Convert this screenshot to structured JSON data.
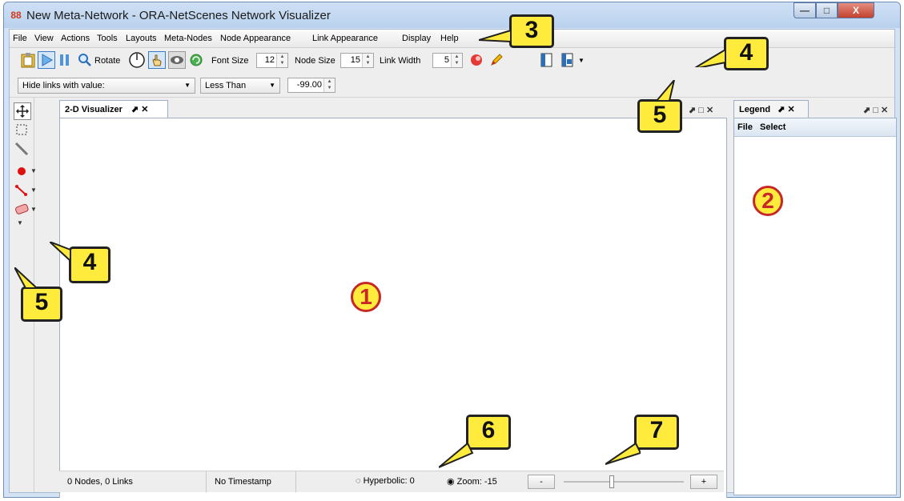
{
  "window": {
    "title": "New Meta-Network - ORA-NetScenes Network Visualizer",
    "minimize": "—",
    "maximize": "□",
    "close": "X"
  },
  "menu": [
    "File",
    "View",
    "Actions",
    "Tools",
    "Layouts",
    "Meta-Nodes",
    "Node Appearance",
    "Link Appearance",
    "Display",
    "Help"
  ],
  "toolbar": {
    "rotate_label": "Rotate",
    "font_size_label": "Font Size",
    "font_size_value": "12",
    "node_size_label": "Node Size",
    "node_size_value": "15",
    "link_width_label": "Link Width",
    "link_width_value": "5"
  },
  "filter": {
    "hide_links": "Hide links with value:",
    "comparison": "Less Than",
    "threshold": "-99.00"
  },
  "visualizer_tab": {
    "title": "2-D Visualizer",
    "controls": "⬈ ✕"
  },
  "visualizer_panel_controls": "⬈ □ ✕",
  "legend": {
    "title": "Legend",
    "controls": "⬈ ✕",
    "panel_controls": "⬈ □ ✕",
    "menu_file": "File",
    "menu_select": "Select"
  },
  "status": {
    "nodes_links": "0 Nodes, 0 Links",
    "timestamp": "No Timestamp",
    "hyperbolic": "Hyperbolic: 0",
    "zoom": "Zoom: -15",
    "zoom_out": "-",
    "zoom_in": "+",
    "zoom_slider_level": 0.4
  },
  "annotations": {
    "c1": "1",
    "c2": "2",
    "c3": "3",
    "c4a": "4",
    "c4b": "4",
    "c5a": "5",
    "c5b": "5",
    "c6": "6",
    "c7": "7"
  },
  "icons": [
    "clipboard-icon",
    "play-icon",
    "pause-icon",
    "magnifier-icon",
    "rotate-dial-icon",
    "hand-pointer-icon",
    "eye-icon",
    "refresh-icon",
    "color-wheel-icon",
    "pencil-icon",
    "export-icon",
    "export-dropdown-icon",
    "move-icon",
    "select-rect-icon",
    "lasso-icon",
    "add-node-icon",
    "add-link-icon",
    "eraser-icon"
  ],
  "colors": {
    "accent_red": "#c62828",
    "callout_yellow": "#ffeb3b",
    "node_red": "#e01010"
  }
}
